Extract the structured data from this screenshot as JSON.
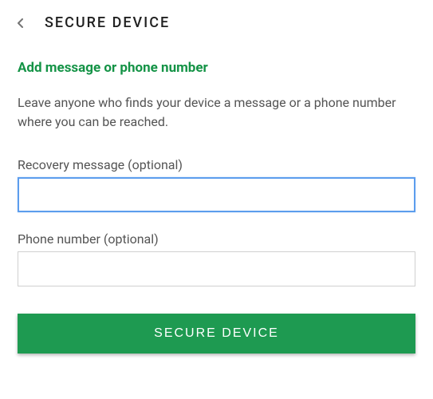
{
  "header": {
    "title": "SECURE DEVICE"
  },
  "main": {
    "subtitle": "Add message or phone number",
    "description": "Leave anyone who finds your device a message or a phone number where you can be reached.",
    "fields": {
      "recovery_message": {
        "label": "Recovery message (optional)",
        "value": ""
      },
      "phone_number": {
        "label": "Phone number (optional)",
        "value": ""
      }
    }
  },
  "actions": {
    "primary_button_label": "SECURE DEVICE"
  },
  "colors": {
    "accent": "#149346",
    "button": "#1e9a51",
    "focus": "#5c9ded"
  }
}
